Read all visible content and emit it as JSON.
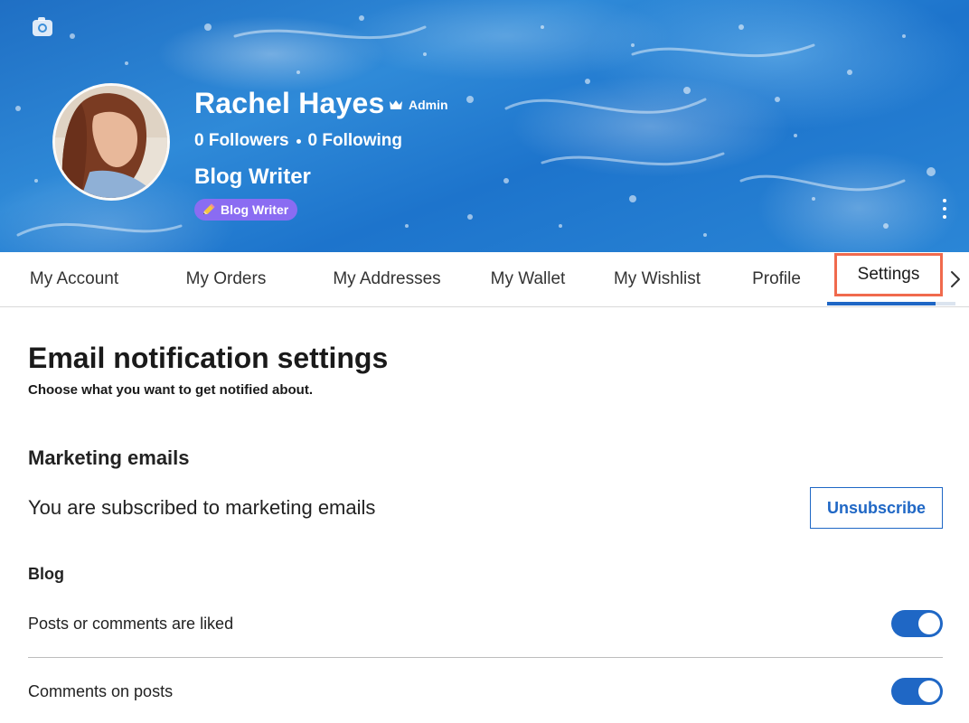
{
  "profile": {
    "name": "Rachel Hayes",
    "admin_label": "Admin",
    "followers_text": "0 Followers",
    "following_text": "0 Following",
    "title": "Blog Writer",
    "badge_label": "Blog Writer"
  },
  "tabs": [
    {
      "label": "My Account"
    },
    {
      "label": "My Orders"
    },
    {
      "label": "My Addresses"
    },
    {
      "label": "My Wallet"
    },
    {
      "label": "My Wishlist"
    },
    {
      "label": "Profile"
    },
    {
      "label": "Settings",
      "active": true
    }
  ],
  "settings": {
    "title": "Email notification settings",
    "subtitle": "Choose what you want to get notified about.",
    "marketing": {
      "title": "Marketing emails",
      "status": "You are subscribed to marketing emails",
      "unsubscribe_label": "Unsubscribe"
    },
    "blog": {
      "title": "Blog",
      "items": [
        {
          "label": "Posts or comments are liked",
          "enabled": true
        },
        {
          "label": "Comments on posts",
          "enabled": true
        }
      ]
    }
  },
  "colors": {
    "accent": "#1f67c5",
    "badge": "#8a6cf2",
    "highlight": "#f06a4d"
  },
  "icons": [
    "camera-icon",
    "crown-icon",
    "pencil-icon",
    "more-vertical-icon",
    "chevron-right-icon"
  ]
}
